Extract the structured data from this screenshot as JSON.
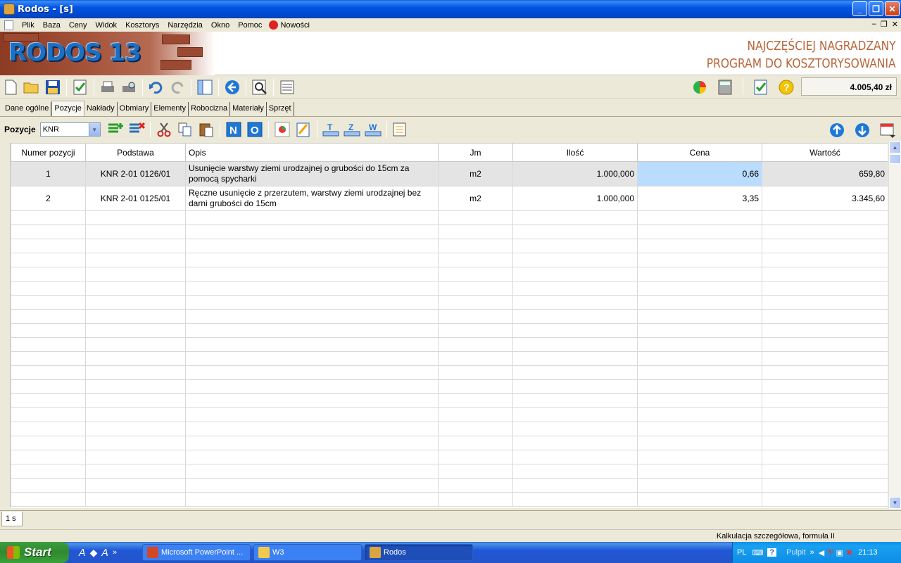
{
  "window": {
    "title": "Rodos - [s]"
  },
  "menu": [
    "Plik",
    "Baza",
    "Ceny",
    "Widok",
    "Kosztorys",
    "Narzędzia",
    "Okno",
    "Pomoc",
    "Nowości"
  ],
  "banner": {
    "logo_text": "RODOS 13",
    "slogan_line1": "NAJCZĘŚCIEJ NAGRADZANY",
    "slogan_line2": "PROGRAM DO KOSZTORYSOWANIA"
  },
  "toolbar": {
    "total": "4.005,40 zł"
  },
  "tabs": [
    "Dane ogólne",
    "Pozycje",
    "Nakłady",
    "Obmiary",
    "Elementy",
    "Robocizna",
    "Materiały",
    "Sprzęt"
  ],
  "positions_bar": {
    "label": "Pozycje",
    "catalog_value": "KNR",
    "tool_letters": [
      "N",
      "O",
      "T",
      "Z",
      "W"
    ]
  },
  "grid": {
    "columns": [
      "Numer pozycji",
      "Podstawa",
      "Opis",
      "Jm",
      "Ilość",
      "Cena",
      "Wartość"
    ],
    "rows": [
      {
        "nr": "1",
        "podstawa": "KNR 2-01 0126/01",
        "opis": "Usunięcie warstwy ziemi urodzajnej o grubości do 15cm za pomocą spycharki",
        "jm": "m2",
        "ilosc": "1.000,000",
        "cena": "0,66",
        "wartosc": "659,80"
      },
      {
        "nr": "2",
        "podstawa": "KNR 2-01 0125/01",
        "opis": "Ręczne usunięcie z przerzutem, warstwy ziemi urodzajnej bez darni grubości do 15cm",
        "jm": "m2",
        "ilosc": "1.000,000",
        "cena": "3,35",
        "wartosc": "3.345,60"
      }
    ]
  },
  "sheet_tab": "1 s",
  "status": {
    "text": "Kalkulacja szczegółowa, formuła II"
  },
  "taskbar": {
    "start": "Start",
    "tasks": [
      "Microsoft PowerPoint ...",
      "W3",
      "Rodos"
    ],
    "lang": "PL",
    "desktop": "Pulpit",
    "clock": "21:13"
  },
  "colors": {
    "selected_cell": "#b9dcff",
    "selected_row": "#e4e4e4",
    "titlebar": "#0055e5",
    "slogan": "#b8663a"
  }
}
